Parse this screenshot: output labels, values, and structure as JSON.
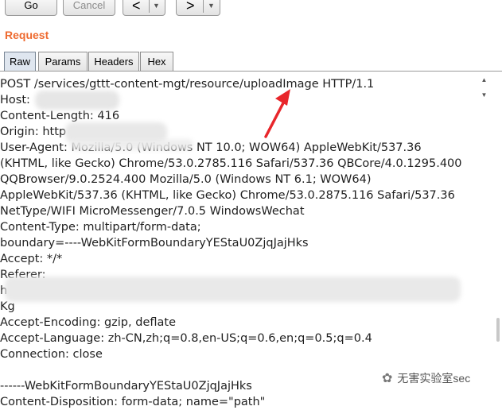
{
  "toolbar": {
    "go_label": "Go",
    "cancel_label": "Cancel",
    "back_label": "<",
    "back_dropdown": "▼",
    "forward_label": ">",
    "forward_dropdown": "▼"
  },
  "panel": {
    "title": "Request",
    "tabs": [
      {
        "label": "Raw",
        "active": true
      },
      {
        "label": "Params",
        "active": false
      },
      {
        "label": "Headers",
        "active": false
      },
      {
        "label": "Hex",
        "active": false
      }
    ]
  },
  "request_lines": [
    "POST /services/gttt-content-mgt/resource/uploadImage HTTP/1.1",
    "Host:",
    "Content-Length: 416",
    "Origin: http",
    "User-Agent: Mozilla/5.0 (Windows NT 10.0; WOW64) AppleWebKit/537.36",
    "(KHTML, like Gecko) Chrome/53.0.2785.116 Safari/537.36 QBCore/4.0.1295.400",
    "QQBrowser/9.0.2524.400 Mozilla/5.0 (Windows NT 6.1; WOW64)",
    "AppleWebKit/537.36 (KHTML, like Gecko) Chrome/53.0.2875.116 Safari/537.36",
    "NetType/WIFI MicroMessenger/7.0.5 WindowsWechat",
    "Content-Type: multipart/form-data;",
    "boundary=----WebKitFormBoundaryYEStaU0ZjqJajHks",
    "Accept: */*",
    "Referer:",
    "h",
    "Kg",
    "Accept-Encoding: gzip, deflate",
    "Accept-Language: zh-CN,zh;q=0.8,en-US;q=0.6,en;q=0.5;q=0.4",
    "Connection: close",
    "",
    "------WebKitFormBoundaryYEStaU0ZjqJajHks",
    "Content-Disposition: form-data; name=\"path\""
  ],
  "watermark": {
    "text": "无害实验室sec",
    "icon": "wechat-icon"
  },
  "colors": {
    "title": "#ee6a2f",
    "arrow": "#e8262b"
  }
}
